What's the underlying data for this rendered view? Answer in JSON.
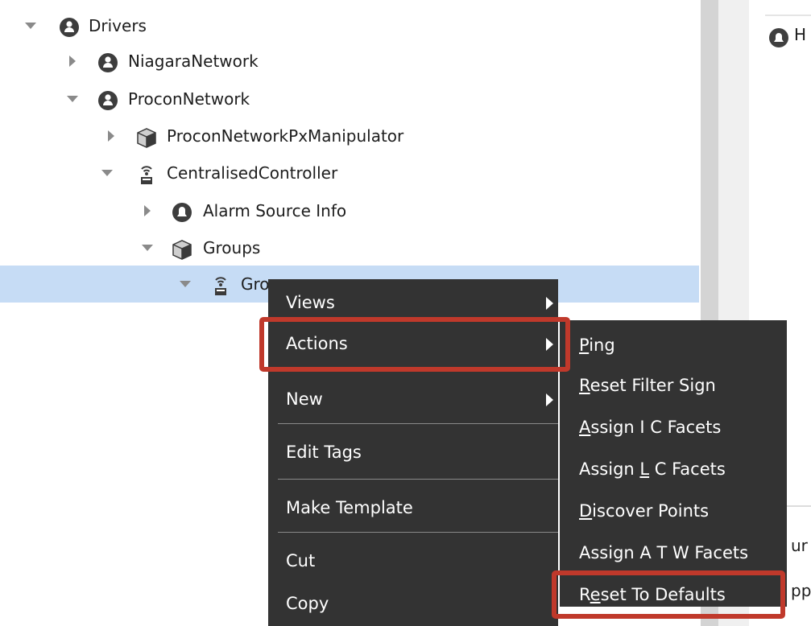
{
  "tree": {
    "nodes": [
      {
        "label": "Drivers",
        "icon": "network-folder-icon",
        "expander": "expanded"
      },
      {
        "label": "NiagaraNetwork",
        "icon": "network-folder-icon",
        "expander": "collapsed"
      },
      {
        "label": "ProconNetwork",
        "icon": "network-folder-icon",
        "expander": "expanded"
      },
      {
        "label": "ProconNetworkPxManipulator",
        "icon": "px-cube-icon",
        "expander": "collapsed"
      },
      {
        "label": "CentralisedController",
        "icon": "device-antenna-icon",
        "expander": "expanded"
      },
      {
        "label": "Alarm Source Info",
        "icon": "alarm-source-icon",
        "expander": "collapsed"
      },
      {
        "label": "Groups",
        "icon": "folder-cube-icon",
        "expander": "expanded"
      },
      {
        "label": "Gro",
        "icon": "device-antenna-icon",
        "expander": "expanded",
        "selected": true
      }
    ]
  },
  "context_menu": {
    "items": [
      {
        "label": "Views",
        "has_submenu": true
      },
      {
        "label": "Actions",
        "has_submenu": true,
        "highlighted": true
      },
      {
        "label": "New",
        "has_submenu": true
      },
      {
        "label": "Edit Tags",
        "has_submenu": false
      },
      {
        "label": "Make Template",
        "has_submenu": false
      },
      {
        "label": "Cut",
        "has_submenu": false
      },
      {
        "label": "Copy",
        "has_submenu": false
      }
    ]
  },
  "actions_submenu": {
    "items": [
      {
        "label": "Ping",
        "mnemonic_index": 0
      },
      {
        "label": "Reset Filter Sign",
        "mnemonic_index": 0
      },
      {
        "label": "Assign I C Facets",
        "mnemonic_index": 0
      },
      {
        "label": "Assign L C Facets",
        "mnemonic_index": 7
      },
      {
        "label": "Discover Points",
        "mnemonic_index": 0
      },
      {
        "label": "Assign A T W Facets",
        "mnemonic_index": -1
      },
      {
        "label": "Reset To Defaults",
        "mnemonic_index": 1,
        "highlighted": true
      }
    ]
  },
  "right_panel": {
    "item_label": "H",
    "lower_text_1": "ur",
    "lower_text_2": "pp"
  },
  "colors": {
    "menu_background": "#333333",
    "highlight_outline": "#c0392b",
    "selected_row": "#c6dcf5"
  }
}
